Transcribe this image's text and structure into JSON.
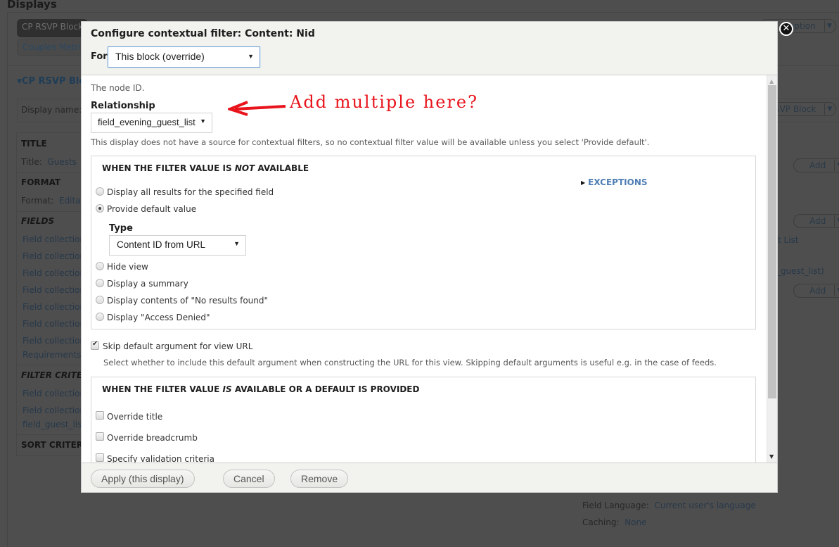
{
  "background": {
    "page_title": "Displays",
    "display_tabs": [
      {
        "label": "CP RSVP Block",
        "active": true
      },
      {
        "label": "Couples Metri",
        "active": false
      }
    ],
    "section_heading": "CP RSVP Blo",
    "display_name_label": "Display name:",
    "sections": [
      {
        "heading": "TITLE",
        "items": [
          {
            "key": "Title:",
            "value": "Guests"
          }
        ]
      },
      {
        "heading": "FORMAT",
        "items": [
          {
            "key": "Format:",
            "value": "Editab"
          }
        ]
      },
      {
        "heading": "FIELDS",
        "items": [
          "Field collection",
          "Field collection",
          "Field collection",
          "Field collection",
          "Field collection",
          "Field collection",
          "Field collection",
          "Requirements)"
        ]
      },
      {
        "heading": "FILTER CRITER",
        "items": [
          "Field collection",
          "Field collection",
          "field_guest_list"
        ]
      },
      {
        "heading": "SORT CRITERIA",
        "items": []
      }
    ],
    "right_column": {
      "description_button": "ription",
      "display_name_select": "SVP Block",
      "add_buttons": [
        "Add",
        "Add",
        "Add"
      ],
      "fragments": [
        "t List",
        "ld_guest_list)"
      ],
      "settings": [
        {
          "key": "Field Language:",
          "value": "Current user's language"
        },
        {
          "key": "Caching:",
          "value": "None"
        }
      ]
    }
  },
  "dialog": {
    "title": "Configure contextual filter: Content: Nid",
    "for_label": "For",
    "for_select": "This block (override)",
    "node_desc": "The node ID.",
    "relationship_label": "Relationship",
    "relationship_select": "field_evening_guest_list",
    "relationship_desc": "This display does not have a source for contextual filters, so no contextual filter value will be available unless you select 'Provide default'.",
    "annotation": "Add multiple here?",
    "not_available": {
      "legend_prefix": "WHEN THE FILTER VALUE IS ",
      "legend_em": "NOT",
      "legend_suffix": " AVAILABLE",
      "exceptions_label": "EXCEPTIONS",
      "options": [
        {
          "label": "Display all results for the specified field",
          "checked": false
        },
        {
          "label": "Provide default value",
          "checked": true
        },
        {
          "label": "Hide view",
          "checked": false
        },
        {
          "label": "Display a summary",
          "checked": false
        },
        {
          "label": "Display contents of \"No results found\"",
          "checked": false
        },
        {
          "label": "Display \"Access Denied\"",
          "checked": false
        }
      ],
      "type_label": "Type",
      "type_select": "Content ID from URL"
    },
    "skip_default": {
      "label": "Skip default argument for view URL",
      "checked": true,
      "desc": "Select whether to include this default argument when constructing the URL for this view. Skipping default arguments is useful e.g. in the case of feeds."
    },
    "available": {
      "legend_prefix": "WHEN THE FILTER VALUE ",
      "legend_em": "IS",
      "legend_suffix": " AVAILABLE OR A DEFAULT IS PROVIDED",
      "options": [
        {
          "label": "Override title",
          "checked": false
        },
        {
          "label": "Override breadcrumb",
          "checked": false
        },
        {
          "label": "Specify validation criteria",
          "checked": false
        }
      ]
    },
    "buttons": {
      "apply": "Apply (this display)",
      "cancel": "Cancel",
      "remove": "Remove"
    }
  }
}
